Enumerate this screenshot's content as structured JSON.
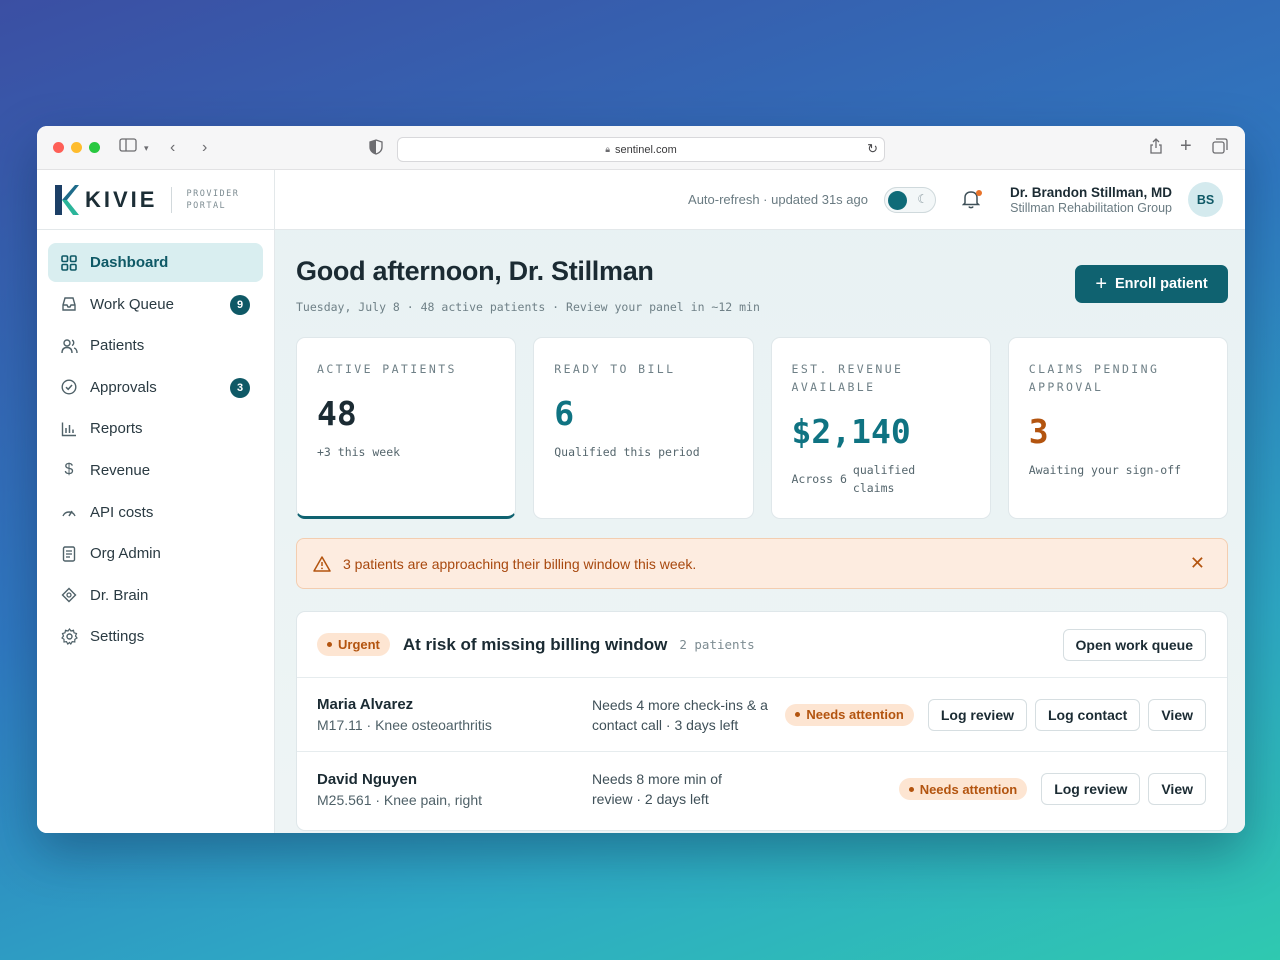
{
  "browser": {
    "url": "sentinel.com"
  },
  "brand": {
    "name": "KIVIE",
    "sub_line1": "PROVIDER",
    "sub_line2": "PORTAL"
  },
  "sidebar": {
    "items": [
      {
        "label": "Dashboard",
        "icon": "grid-icon",
        "active": true
      },
      {
        "label": "Work Queue",
        "icon": "inbox-icon",
        "badge": "9"
      },
      {
        "label": "Patients",
        "icon": "users-icon"
      },
      {
        "label": "Approvals",
        "icon": "check-circle-icon",
        "badge": "3"
      },
      {
        "label": "Reports",
        "icon": "bar-chart-icon"
      },
      {
        "label": "Revenue",
        "icon": "dollar-icon"
      },
      {
        "label": "API costs",
        "icon": "gauge-icon"
      },
      {
        "label": "Org Admin",
        "icon": "document-icon"
      },
      {
        "label": "Dr. Brain",
        "icon": "diamond-icon"
      },
      {
        "label": "Settings",
        "icon": "gear-icon"
      }
    ]
  },
  "topbar": {
    "refresh": "Auto-refresh · updated 31s ago",
    "user_name": "Dr. Brandon Stillman, MD",
    "user_org": "Stillman Rehabilitation Group",
    "avatar": "BS"
  },
  "header": {
    "greeting": "Good afternoon, Dr. Stillman",
    "subline": "Tuesday, July 8 · 48 active patients · Review your panel in ~12 min",
    "enroll_label": "Enroll patient"
  },
  "stats": [
    {
      "label": "ACTIVE PATIENTS",
      "value": "48",
      "note": "+3 this week"
    },
    {
      "label": "READY TO BILL",
      "value": "6",
      "note": "Qualified this period"
    },
    {
      "label": "EST. REVENUE AVAILABLE",
      "value": "$2,140",
      "note_prefix": "Across 6",
      "note_suffix": "qualified claims"
    },
    {
      "label": "CLAIMS PENDING APPROVAL",
      "value": "3",
      "note": "Awaiting your sign-off"
    }
  ],
  "alert": {
    "text": "3 patients are approaching their billing window this week."
  },
  "panel": {
    "pill": "Urgent",
    "title": "At risk of missing billing window",
    "count": "2 patients",
    "open_label": "Open work queue",
    "rows": [
      {
        "name": "Maria Alvarez",
        "dx": "M17.11 · Knee osteoarthritis",
        "need": "Needs 4 more check-ins & a contact call · 3 days left",
        "status": "Needs attention",
        "actions": [
          "Log review",
          "Log contact",
          "View"
        ]
      },
      {
        "name": "David Nguyen",
        "dx": "M25.561 · Knee pain, right",
        "need": "Needs 8 more min of review · 2 days left",
        "status": "Needs attention",
        "actions": [
          "Log review",
          "View"
        ]
      }
    ]
  },
  "colors": {
    "accent": "#0f6270",
    "warning": "#b3540f",
    "alert_bg": "#fdece0"
  }
}
